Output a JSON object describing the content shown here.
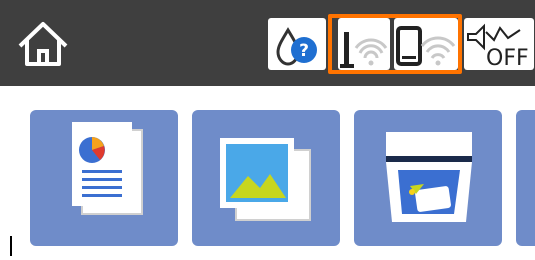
{
  "topbar": {
    "icons": [
      "home-icon",
      "ink-level-icon",
      "wifi-icon",
      "wifi-direct-icon",
      "eco-off-icon"
    ]
  },
  "status": {
    "eco_label": "OFF"
  },
  "menu": {
    "tiles": [
      "copy-icon",
      "photo-icon",
      "scan-icon",
      "more-icon"
    ]
  }
}
